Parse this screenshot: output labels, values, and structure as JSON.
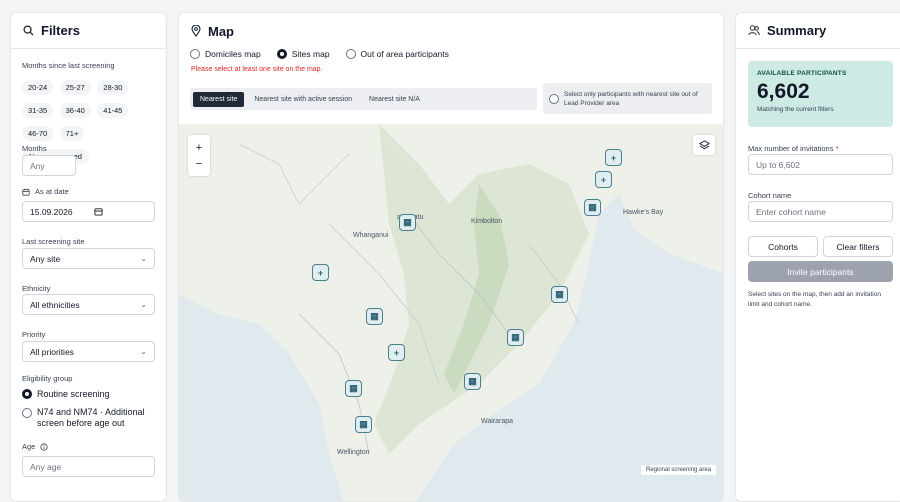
{
  "filters": {
    "title": "Filters",
    "months_since_label": "Months since last screening",
    "month_chips": [
      "20-24",
      "25-27",
      "28-30",
      "31-35",
      "36-40",
      "41-45",
      "46-70",
      "71+",
      "Never screened"
    ],
    "months_label": "Months",
    "months_placeholder": "Any",
    "as_at_date_label": "As at date",
    "as_at_date_value": "15.09.2026",
    "last_site_label": "Last screening site",
    "last_site_value": "Any site",
    "ethnicity_label": "Ethnicity",
    "ethnicity_value": "All ethnicities",
    "priority_label": "Priority",
    "priority_value": "All priorities",
    "eligibility_label": "Eligibility group",
    "eligibility_options": [
      "Routine screening",
      "N74 and NM74 · Additional screen before age out"
    ],
    "age_label": "Age",
    "age_placeholder": "Any age"
  },
  "map": {
    "title": "Map",
    "view_options": [
      "Domiciles map",
      "Sites map",
      "Out of area participants"
    ],
    "selected_view": "Sites map",
    "error_text": "Please select at least one site on the map.",
    "tabs": [
      "Nearest site",
      "Nearest site with active session",
      "Nearest site N/A"
    ],
    "active_tab": "Nearest site",
    "lead_provider_text": "Select only participants with nearest site out of Lead Provider area",
    "zoom_in": "+",
    "zoom_out": "−",
    "legend_text": "Regional screening area",
    "places": [
      "Whanganui",
      "Kimbolton",
      "Wairarapa",
      "Wellington"
    ],
    "places_partial": [
      "anawatu",
      "Hawke's Bay"
    ]
  },
  "summary": {
    "title": "Summary",
    "available_label": "AVAILABLE PARTICIPANTS",
    "available_count": "6,602",
    "matching_text": "Matching the current filters",
    "max_invitations_label": "Max number of invitations",
    "required_mark": "*",
    "max_invitations_placeholder": "Up to 6,602",
    "cohort_name_label": "Cohort name",
    "cohort_name_placeholder": "Enter cohort name",
    "cohorts_button": "Cohorts",
    "clear_filters_button": "Clear filters",
    "invite_button": "Invite participants",
    "hint_text": "Select sites on the map, then add an invitation limit and cohort name."
  },
  "colors": {
    "accent_teal": "#cdeae4",
    "invite_bg": "#9ca3af",
    "error_red": "#dc2626",
    "marker_teal": "#4b7f8c"
  }
}
